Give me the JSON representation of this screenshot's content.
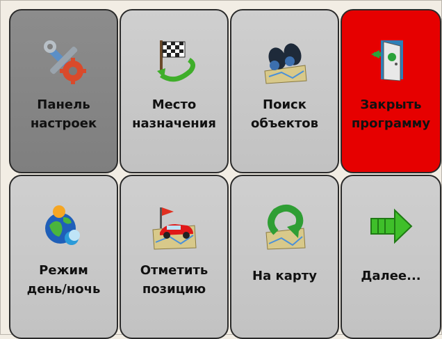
{
  "menu": {
    "tiles": [
      {
        "line1": "Панель",
        "line2": "настроек",
        "icon": "settings-tools-icon",
        "state": "selected"
      },
      {
        "line1": "Место",
        "line2": "назначения",
        "icon": "destination-flag-icon"
      },
      {
        "line1": "Поиск",
        "line2": "объектов",
        "icon": "binoculars-icon"
      },
      {
        "line1": "Закрыть",
        "line2": "программу",
        "icon": "exit-door-icon",
        "color": "#e60000"
      },
      {
        "line1": "Режим",
        "line2": "день/ночь",
        "icon": "globe-day-night-icon"
      },
      {
        "line1": "Отметить",
        "line2": "позицию",
        "icon": "car-map-pin-icon"
      },
      {
        "line1": "На карту",
        "icon": "map-return-arrow-icon"
      },
      {
        "line1": "Далее...",
        "icon": "next-arrow-icon"
      }
    ]
  }
}
